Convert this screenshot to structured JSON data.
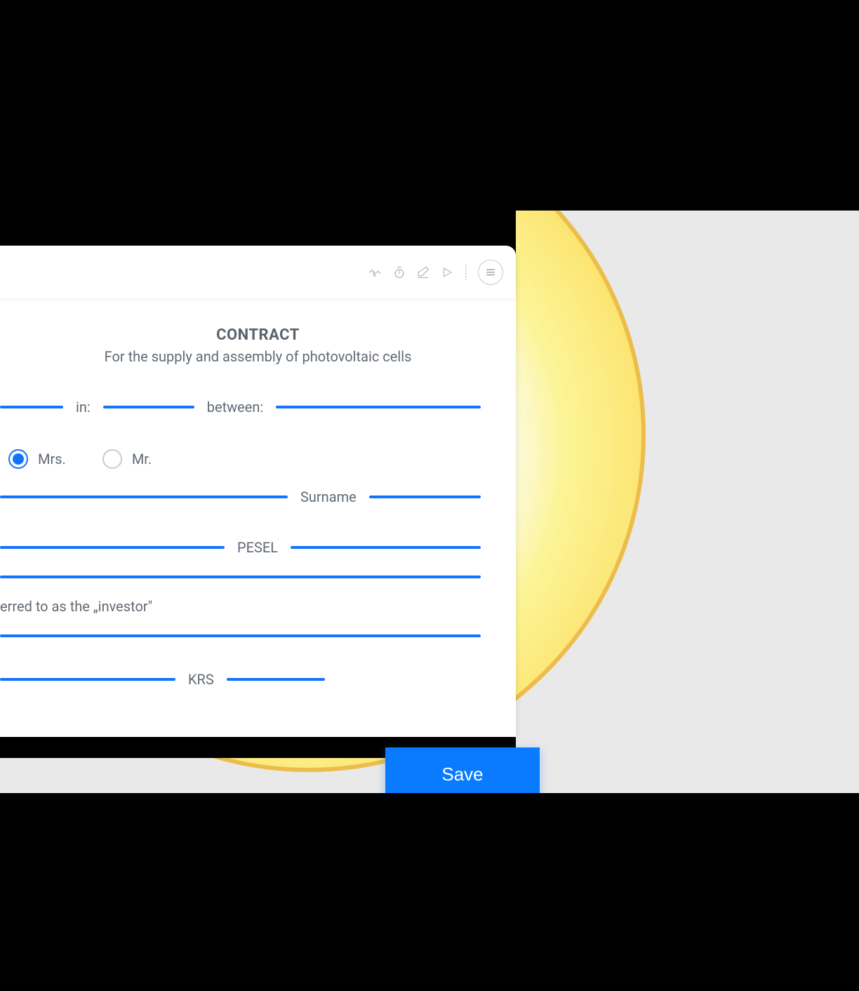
{
  "toolbar": {
    "icons": [
      "handshake-icon",
      "timer-icon",
      "eraser-icon",
      "play-icon"
    ],
    "menu": "menu"
  },
  "doc": {
    "title": "CONTRACT",
    "subtitle": "For the supply and assembly of photovoltaic cells",
    "line_in": "in:",
    "line_between": "between:",
    "salutation": {
      "mrs": "Mrs.",
      "mr": "Mr.",
      "selected": "mrs"
    },
    "surname_label": "Surname",
    "pesel_label": "PESEL",
    "investor_note": "erred to as the „investor\"",
    "krs_label": "KRS"
  },
  "actions": {
    "save": "Save"
  },
  "colors": {
    "accent": "#1273ff",
    "button": "#0a7bff",
    "yellow": "#ffd23f"
  }
}
